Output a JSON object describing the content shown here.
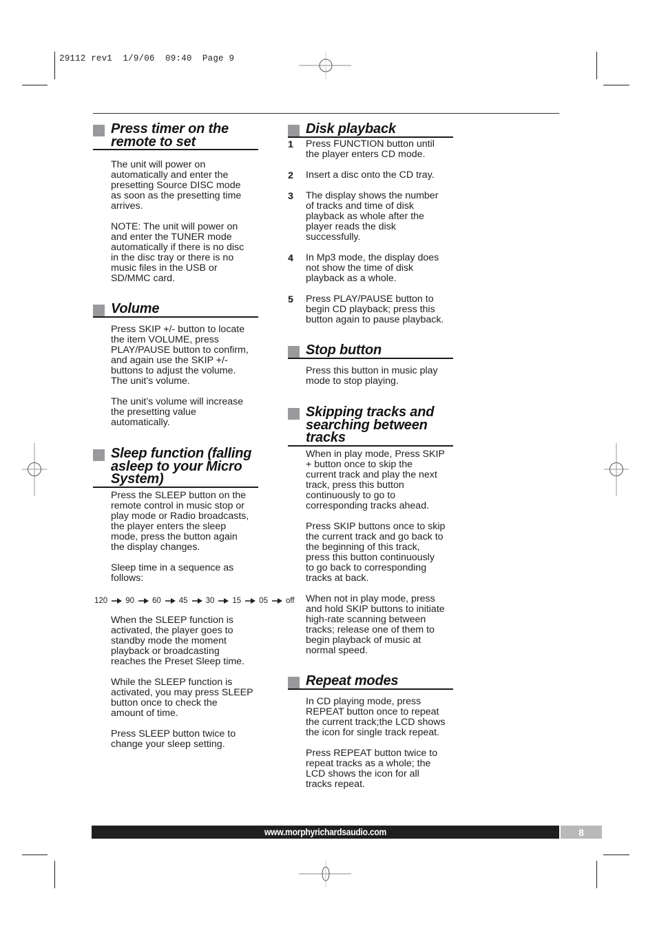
{
  "slug": "29112 rev1  1/9/06  09:40  Page 9",
  "left_column": {
    "timer": {
      "title_lines": [
        "Press timer on the",
        "remote to set"
      ],
      "paragraphs": [
        [
          "The unit will power on",
          "automatically and enter the",
          "presetting Source DISC mode",
          "as soon as the presetting time",
          "arrives."
        ],
        [
          "NOTE: The unit will power on",
          "and enter the TUNER mode",
          "automatically if there is no disc",
          "in the disc tray or there is no",
          "music files in the USB or",
          "SD/MMC card."
        ]
      ]
    },
    "volume": {
      "title_lines": [
        "Volume"
      ],
      "paragraphs": [
        [
          "Press SKIP +/- button to locate",
          "the item VOLUME, press",
          "PLAY/PAUSE button to confirm,",
          "and again use the SKIP +/-",
          "buttons to adjust the volume.",
          "The unit’s volume."
        ],
        [
          "The unit’s volume will increase",
          "the presetting value",
          "automatically."
        ]
      ]
    },
    "sleep": {
      "title_lines": [
        "Sleep function (falling",
        "asleep to your Micro",
        "System)"
      ],
      "paragraphs": [
        [
          "Press the SLEEP button on the",
          "remote control in music stop or",
          "play mode or Radio broadcasts,",
          "the player enters the sleep",
          "mode, press the button again",
          "the display changes."
        ],
        [
          "Sleep time in a sequence as",
          "follows:"
        ]
      ],
      "sequence": [
        "120",
        "90",
        "60",
        "45",
        "30",
        "15",
        "05",
        "off"
      ],
      "paragraphs_after": [
        [
          "When the SLEEP function is",
          "activated, the player goes to",
          "standby mode the moment",
          "playback or broadcasting",
          "reaches the Preset Sleep time."
        ],
        [
          "While the SLEEP function is",
          "activated, you may press SLEEP",
          "button once to check the",
          "amount of time."
        ],
        [
          "Press SLEEP button twice to",
          "change your sleep setting."
        ]
      ]
    }
  },
  "right_column": {
    "disk": {
      "title_lines": [
        "Disk playback"
      ],
      "steps": [
        {
          "num": "1",
          "lines": [
            "Press FUNCTION button until",
            "the player enters CD mode."
          ]
        },
        {
          "num": "2",
          "lines": [
            "Insert a disc onto the CD tray."
          ]
        },
        {
          "num": "3",
          "lines": [
            "The display shows the number",
            "of tracks and time of disk",
            "playback as whole after the",
            "player reads the disk",
            "successfully."
          ]
        },
        {
          "num": "4",
          "lines": [
            "In Mp3 mode, the display does",
            "not show the time of disk",
            "playback as a whole."
          ]
        },
        {
          "num": "5",
          "lines": [
            "Press PLAY/PAUSE button to",
            "begin CD playback; press this",
            "button again to pause playback."
          ]
        }
      ]
    },
    "stop": {
      "title_lines": [
        "Stop button"
      ],
      "paragraphs": [
        [
          "Press this button in music play",
          "mode to stop playing."
        ]
      ]
    },
    "skipping": {
      "title_lines": [
        "Skipping tracks and",
        "searching between",
        "tracks"
      ],
      "paragraphs": [
        [
          "When in play mode, Press SKIP",
          "+ button once to skip the",
          "current track and play the next",
          "track, press this button",
          "continuously to go to",
          "corresponding tracks ahead."
        ],
        [
          "Press SKIP buttons once to skip",
          "the current track and go back to",
          "the beginning of this track,",
          "press this button continuously",
          "to go back to corresponding",
          "tracks at back."
        ],
        [
          "When not in play mode, press",
          "and hold SKIP buttons to initiate",
          "high-rate scanning between",
          "tracks; release one of them to",
          "begin playback of music at",
          "normal speed."
        ]
      ]
    },
    "repeat": {
      "title_lines": [
        "Repeat modes"
      ],
      "paragraphs": [
        [
          "In CD playing mode, press",
          "REPEAT button once to repeat",
          "the current track;the LCD shows",
          "the icon for single track repeat."
        ],
        [
          "Press REPEAT button twice to",
          "repeat tracks as a whole; the",
          "LCD shows the icon for all",
          "tracks repeat."
        ]
      ]
    }
  },
  "footer": {
    "url": "www.morphyrichardsaudio.com",
    "page_number": "8"
  },
  "colors": {
    "heading_square": "#9a9a9c",
    "footer_bar": "#1f1f1f",
    "page_tab": "#b9b9b9"
  }
}
